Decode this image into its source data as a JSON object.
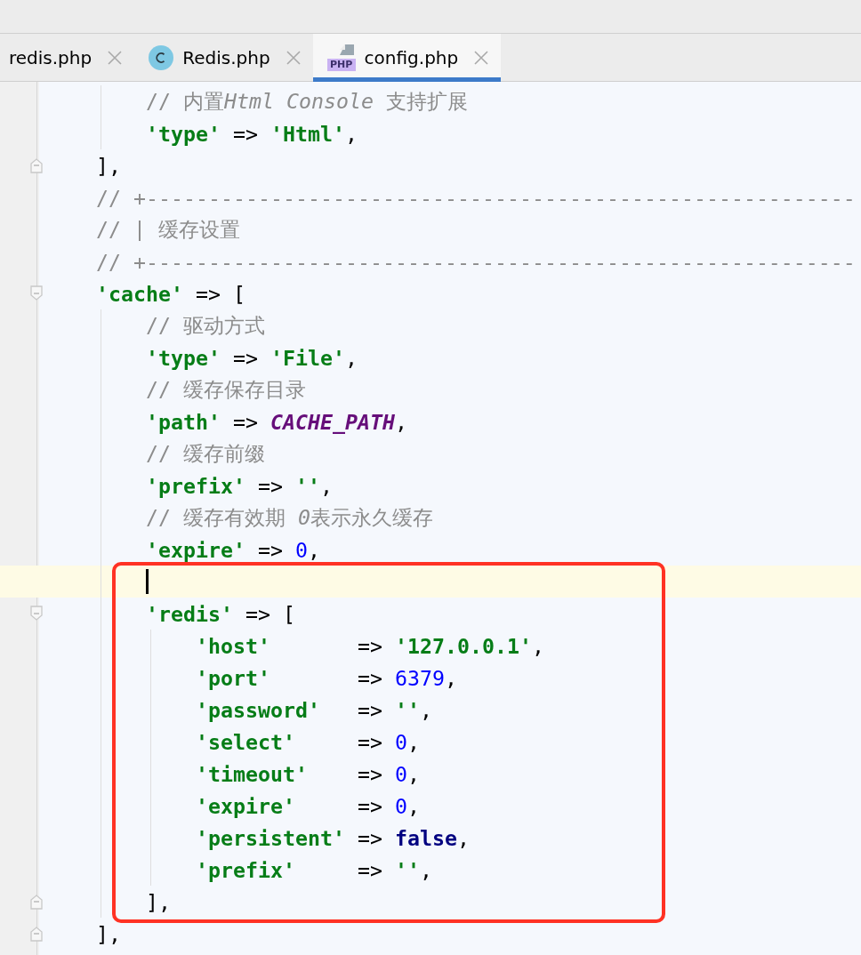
{
  "tabs": [
    {
      "label": "redis.php",
      "kind": "plain",
      "selected": false
    },
    {
      "label": "Redis.php",
      "kind": "class",
      "selected": false
    },
    {
      "label": "config.php",
      "kind": "php",
      "badge": "PHP",
      "selected": true
    }
  ],
  "editor": {
    "lines": [
      {
        "children": [
          {
            "children": [
              {
                "tokens": [
                  {
                    "kind": "comment",
                    "text": "// 内置"
                  },
                  {
                    "kind": "comment-italic",
                    "text": "Html Console"
                  },
                  {
                    "kind": "comment",
                    "text": " 支持扩展"
                  }
                ]
              },
              {
                "tokens": [
                  {
                    "kind": "string",
                    "text": "'type'"
                  },
                  {
                    "kind": "op",
                    "text": " => "
                  },
                  {
                    "kind": "string",
                    "text": "'Html'"
                  },
                  {
                    "kind": "op",
                    "text": ","
                  }
                ]
              }
            ]
          },
          {
            "fold_end": true,
            "tokens": [
              {
                "kind": "op",
                "text": "],"
              }
            ]
          },
          {
            "tokens": [
              {
                "kind": "comment",
                "text": "// +---------------------------------------------------------"
              }
            ]
          },
          {
            "tokens": [
              {
                "kind": "comment",
                "text": "// | 缓存设置"
              }
            ]
          },
          {
            "tokens": [
              {
                "kind": "comment",
                "text": "// +---------------------------------------------------------"
              }
            ]
          },
          {
            "fold_start": true,
            "tokens": [
              {
                "kind": "string",
                "text": "'cache'"
              },
              {
                "kind": "op",
                "text": " => ["
              }
            ],
            "children": [
              {
                "tokens": [
                  {
                    "kind": "comment",
                    "text": "// 驱动方式"
                  }
                ]
              },
              {
                "tokens": [
                  {
                    "kind": "string",
                    "text": "'type'"
                  },
                  {
                    "kind": "op",
                    "text": " => "
                  },
                  {
                    "kind": "string",
                    "text": "'File'"
                  },
                  {
                    "kind": "op",
                    "text": ","
                  }
                ]
              },
              {
                "tokens": [
                  {
                    "kind": "comment",
                    "text": "// 缓存保存目录"
                  }
                ]
              },
              {
                "tokens": [
                  {
                    "kind": "string",
                    "text": "'path'"
                  },
                  {
                    "kind": "op",
                    "text": " => "
                  },
                  {
                    "kind": "constant",
                    "text": "CACHE_PATH"
                  },
                  {
                    "kind": "op",
                    "text": ","
                  }
                ]
              },
              {
                "tokens": [
                  {
                    "kind": "comment",
                    "text": "// 缓存前缀"
                  }
                ]
              },
              {
                "tokens": [
                  {
                    "kind": "string",
                    "text": "'prefix'"
                  },
                  {
                    "kind": "op",
                    "text": " => "
                  },
                  {
                    "kind": "string",
                    "text": "''"
                  },
                  {
                    "kind": "op",
                    "text": ","
                  }
                ]
              },
              {
                "tokens": [
                  {
                    "kind": "comment",
                    "text": "// 缓存有效期 "
                  },
                  {
                    "kind": "comment-italic",
                    "text": "0"
                  },
                  {
                    "kind": "comment",
                    "text": "表示永久缓存"
                  }
                ]
              },
              {
                "tokens": [
                  {
                    "kind": "string",
                    "text": "'expire'"
                  },
                  {
                    "kind": "op",
                    "text": " => "
                  },
                  {
                    "kind": "number",
                    "text": "0"
                  },
                  {
                    "kind": "op",
                    "text": ","
                  }
                ]
              },
              {
                "current": true,
                "caret": true,
                "box_top": true
              },
              {
                "fold_start": true,
                "tokens": [
                  {
                    "kind": "string",
                    "text": "'redis'"
                  },
                  {
                    "kind": "op",
                    "text": " => ["
                  }
                ],
                "children": [
                  {
                    "tokens": [
                      {
                        "kind": "string",
                        "text": "'host'"
                      },
                      {
                        "kind": "op",
                        "text": "       => "
                      },
                      {
                        "kind": "string",
                        "text": "'127.0.0.1'"
                      },
                      {
                        "kind": "op",
                        "text": ","
                      }
                    ]
                  },
                  {
                    "tokens": [
                      {
                        "kind": "string",
                        "text": "'port'"
                      },
                      {
                        "kind": "op",
                        "text": "       => "
                      },
                      {
                        "kind": "number",
                        "text": "6379"
                      },
                      {
                        "kind": "op",
                        "text": ","
                      }
                    ]
                  },
                  {
                    "tokens": [
                      {
                        "kind": "string",
                        "text": "'password'"
                      },
                      {
                        "kind": "op",
                        "text": "   => "
                      },
                      {
                        "kind": "string",
                        "text": "''"
                      },
                      {
                        "kind": "op",
                        "text": ","
                      }
                    ]
                  },
                  {
                    "tokens": [
                      {
                        "kind": "string",
                        "text": "'select'"
                      },
                      {
                        "kind": "op",
                        "text": "     => "
                      },
                      {
                        "kind": "number",
                        "text": "0"
                      },
                      {
                        "kind": "op",
                        "text": ","
                      }
                    ]
                  },
                  {
                    "tokens": [
                      {
                        "kind": "string",
                        "text": "'timeout'"
                      },
                      {
                        "kind": "op",
                        "text": "    => "
                      },
                      {
                        "kind": "number",
                        "text": "0"
                      },
                      {
                        "kind": "op",
                        "text": ","
                      }
                    ]
                  },
                  {
                    "tokens": [
                      {
                        "kind": "string",
                        "text": "'expire'"
                      },
                      {
                        "kind": "op",
                        "text": "     => "
                      },
                      {
                        "kind": "number",
                        "text": "0"
                      },
                      {
                        "kind": "op",
                        "text": ","
                      }
                    ]
                  },
                  {
                    "tokens": [
                      {
                        "kind": "string",
                        "text": "'persistent'"
                      },
                      {
                        "kind": "op",
                        "text": " => "
                      },
                      {
                        "kind": "keyword",
                        "text": "false"
                      },
                      {
                        "kind": "op",
                        "text": ","
                      }
                    ]
                  },
                  {
                    "tokens": [
                      {
                        "kind": "string",
                        "text": "'prefix'"
                      },
                      {
                        "kind": "op",
                        "text": "     => "
                      },
                      {
                        "kind": "string",
                        "text": "''"
                      },
                      {
                        "kind": "op",
                        "text": ","
                      }
                    ]
                  }
                ]
              },
              {
                "fold_end": true,
                "box_bottom": true,
                "tokens": [
                  {
                    "kind": "op",
                    "text": "],"
                  }
                ]
              }
            ]
          },
          {
            "fold_end": true,
            "tokens": [
              {
                "kind": "op",
                "text": "],"
              }
            ]
          }
        ]
      }
    ]
  }
}
